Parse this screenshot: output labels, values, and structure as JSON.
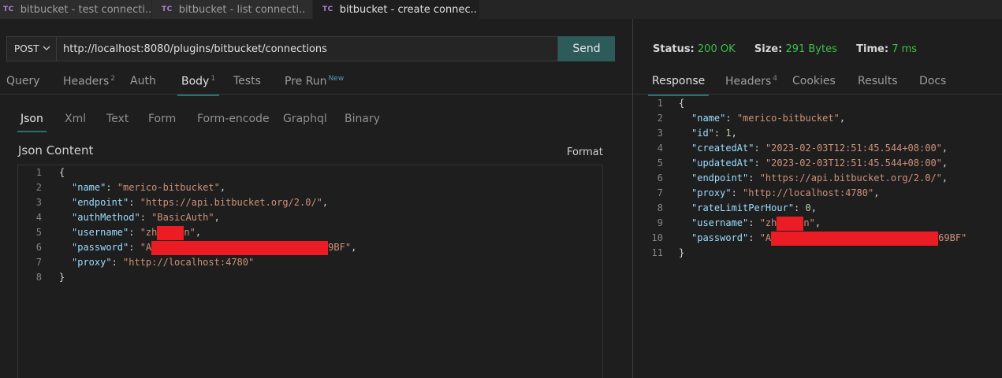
{
  "tabs": [
    {
      "badge": "TC",
      "title": "bitbucket - test connecti.."
    },
    {
      "badge": "TC",
      "title": "bitbucket - list connecti.."
    },
    {
      "badge": "TC",
      "title": "bitbucket - create connec..",
      "close": "✕"
    }
  ],
  "request": {
    "method": "POST",
    "url": "http://localhost:8080/plugins/bitbucket/connections",
    "send_label": "Send",
    "tabs": [
      {
        "label": "Query"
      },
      {
        "label": "Headers",
        "count": "2"
      },
      {
        "label": "Auth"
      },
      {
        "label": "Body",
        "count": "1"
      },
      {
        "label": "Tests"
      },
      {
        "label": "Pre Run",
        "badge": "New"
      }
    ],
    "active_tab": "Body",
    "body_tabs": [
      "Json",
      "Xml",
      "Text",
      "Form",
      "Form-encode",
      "Graphql",
      "Binary"
    ],
    "active_body_tab": "Json",
    "json_content_label": "Json Content",
    "format_label": "Format",
    "code_lines": [
      {
        "n": "1",
        "t": "{"
      },
      {
        "n": "2",
        "key": "\"name\"",
        "val": "\"merico-bitbucket\"",
        "end": ","
      },
      {
        "n": "3",
        "key": "\"endpoint\"",
        "val": "\"https://api.bitbucket.org/2.0/\"",
        "end": ","
      },
      {
        "n": "4",
        "key": "\"authMethod\"",
        "val": "\"BasicAuth\"",
        "end": ","
      },
      {
        "n": "5",
        "key": "\"username\"",
        "val_pre": "\"zh",
        "val_post": "n\"",
        "end": ","
      },
      {
        "n": "6",
        "key": "\"password\"",
        "val_pre": "\"A",
        "val_post": "9BF\"",
        "end": ","
      },
      {
        "n": "7",
        "key": "\"proxy\"",
        "val": "\"http://localhost:4780\"",
        "end": ""
      },
      {
        "n": "8",
        "t": "}"
      }
    ]
  },
  "response": {
    "status_label": "Status:",
    "status_value": "200 OK",
    "size_label": "Size:",
    "size_value": "291 Bytes",
    "time_label": "Time:",
    "time_value": "7 ms",
    "tabs": [
      {
        "label": "Response"
      },
      {
        "label": "Headers",
        "count": "4"
      },
      {
        "label": "Cookies"
      },
      {
        "label": "Results"
      },
      {
        "label": "Docs"
      }
    ],
    "active_tab": "Response",
    "code_lines": [
      {
        "n": "1",
        "t": "{"
      },
      {
        "n": "2",
        "key": "\"name\"",
        "val": "\"merico-bitbucket\"",
        "end": ","
      },
      {
        "n": "3",
        "key": "\"id\"",
        "num": "1",
        "end": ","
      },
      {
        "n": "4",
        "key": "\"createdAt\"",
        "val": "\"2023-02-03T12:51:45.544+08:00\"",
        "end": ","
      },
      {
        "n": "5",
        "key": "\"updatedAt\"",
        "val": "\"2023-02-03T12:51:45.544+08:00\"",
        "end": ","
      },
      {
        "n": "6",
        "key": "\"endpoint\"",
        "val": "\"https://api.bitbucket.org/2.0/\"",
        "end": ","
      },
      {
        "n": "7",
        "key": "\"proxy\"",
        "val": "\"http://localhost:4780\"",
        "end": ","
      },
      {
        "n": "8",
        "key": "\"rateLimitPerHour\"",
        "num": "0",
        "end": ","
      },
      {
        "n": "9",
        "key": "\"username\"",
        "val_pre": "\"zh",
        "val_post": "n\"",
        "end": ","
      },
      {
        "n": "10",
        "key": "\"password\"",
        "val_pre": "\"A",
        "val_post": "69BF\"",
        "end": ""
      },
      {
        "n": "11",
        "t": "}"
      }
    ]
  },
  "colors": {
    "accent": "#2c5b5a",
    "status_ok": "#3dbf4a",
    "redaction": "#ec1c24"
  }
}
